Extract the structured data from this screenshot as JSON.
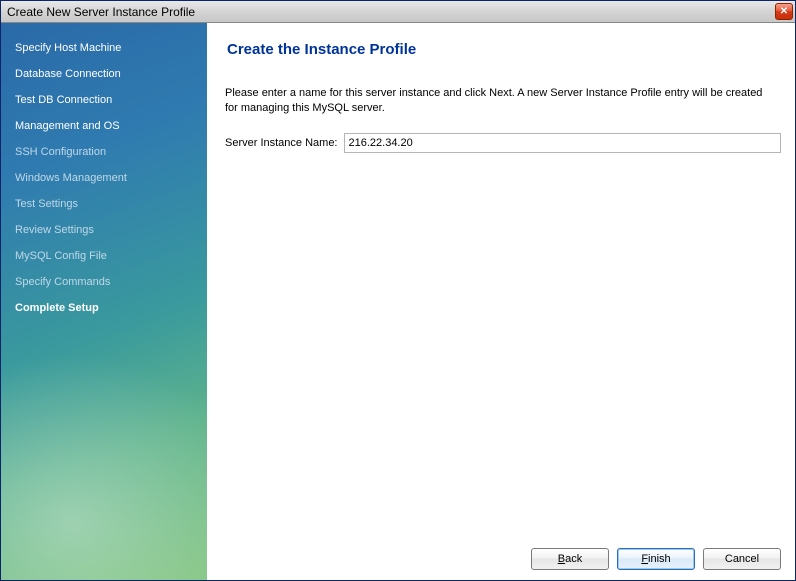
{
  "window": {
    "title": "Create New Server Instance Profile"
  },
  "sidebar": {
    "steps": [
      {
        "label": "Specify Host Machine",
        "state": "done"
      },
      {
        "label": "Database Connection",
        "state": "done"
      },
      {
        "label": "Test DB Connection",
        "state": "done"
      },
      {
        "label": "Management and OS",
        "state": "done"
      },
      {
        "label": "SSH Configuration",
        "state": "pending"
      },
      {
        "label": "Windows Management",
        "state": "pending"
      },
      {
        "label": "Test Settings",
        "state": "pending"
      },
      {
        "label": "Review Settings",
        "state": "pending"
      },
      {
        "label": "MySQL Config File",
        "state": "pending"
      },
      {
        "label": "Specify Commands",
        "state": "pending"
      },
      {
        "label": "Complete Setup",
        "state": "active"
      }
    ]
  },
  "main": {
    "heading": "Create the Instance Profile",
    "description": "Please enter a name for this server instance and click Next. A new Server Instance Profile entry will be created for managing this MySQL server.",
    "field_label": "Server Instance Name:",
    "field_value": "216.22.34.20"
  },
  "footer": {
    "back": "Back",
    "finish": "Finish",
    "cancel": "Cancel"
  }
}
